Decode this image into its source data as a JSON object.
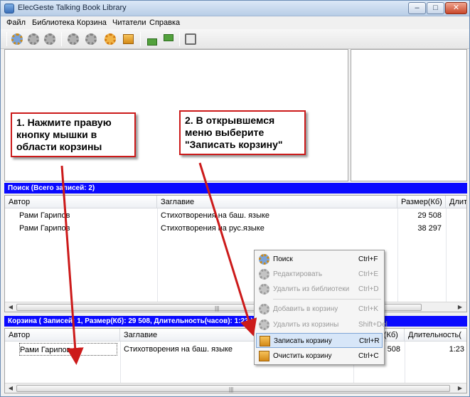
{
  "window": {
    "title": "ElecGeste Talking Book Library",
    "minimize": "–",
    "maximize": "□",
    "close": "✕"
  },
  "menu": [
    "Файл",
    "Библиотека",
    "Корзина",
    "Читатели",
    "Справка"
  ],
  "toolbar": {
    "icons": [
      "search-gear-icon",
      "edit-gear-icon",
      "delete-gear-icon",
      "add-to-basket-gear-icon",
      "remove-gear-icon",
      "write-basket-icon",
      "clear-basket-icon",
      "upload-icon",
      "download-icon",
      "settings-tools-icon"
    ]
  },
  "search": {
    "header": "Поиск (Всего записей: 2)",
    "columns": [
      "Автор",
      "Заглавие",
      "Размер(Кб)",
      "Длите"
    ],
    "rows": [
      {
        "author": "Рами Гарипов",
        "title": "Стихотворения на баш. языке",
        "size": "29 508"
      },
      {
        "author": "Рами Гарипов",
        "title": "Стихотворения на рус.языке",
        "size": "38 297"
      }
    ]
  },
  "basket": {
    "header": "Корзина ( Записей: 1, Размер(Кб): 29 508, Длительность(часов): 1:23 )",
    "columns": [
      "Автор",
      "Заглавие",
      "Размер(Кб)",
      "Длительность("
    ],
    "rows": [
      {
        "author": "Рами Гарипов",
        "title": "Стихотворения на баш. языке",
        "size": "29 508",
        "duration": "1:23"
      }
    ]
  },
  "context_menu": [
    {
      "label": "Поиск",
      "shortcut": "Ctrl+F",
      "enabled": true,
      "icon": "search-gear-icon"
    },
    {
      "label": "Редактировать",
      "shortcut": "Ctrl+E",
      "enabled": false,
      "icon": "edit-gear-icon"
    },
    {
      "label": "Удалить из библиотеки",
      "shortcut": "Ctrl+D",
      "enabled": false,
      "icon": "delete-gear-icon"
    },
    {
      "label": "Добавить в корзину",
      "shortcut": "Ctrl+K",
      "enabled": false,
      "icon": "add-gear-icon"
    },
    {
      "label": "Удалить из корзины",
      "shortcut": "Shift+Del",
      "enabled": false,
      "icon": "remove-gear-icon"
    },
    {
      "label": "Записать корзину",
      "shortcut": "Ctrl+R",
      "enabled": true,
      "highlighted": true,
      "icon": "write-basket-icon"
    },
    {
      "label": "Очистить корзину",
      "shortcut": "Ctrl+C",
      "enabled": true,
      "icon": "clear-basket-icon"
    }
  ],
  "annotations": {
    "step1": [
      "1. Нажмите правую",
      "кнопку мышки в",
      "области корзины"
    ],
    "step2": [
      "2. В открывшемся",
      "меню выберите",
      "\"Записать корзину\""
    ]
  },
  "colors": {
    "panel_header": "#0a0aff",
    "annotation": "#cc1a1a",
    "highlight": "#d7e6f8"
  }
}
